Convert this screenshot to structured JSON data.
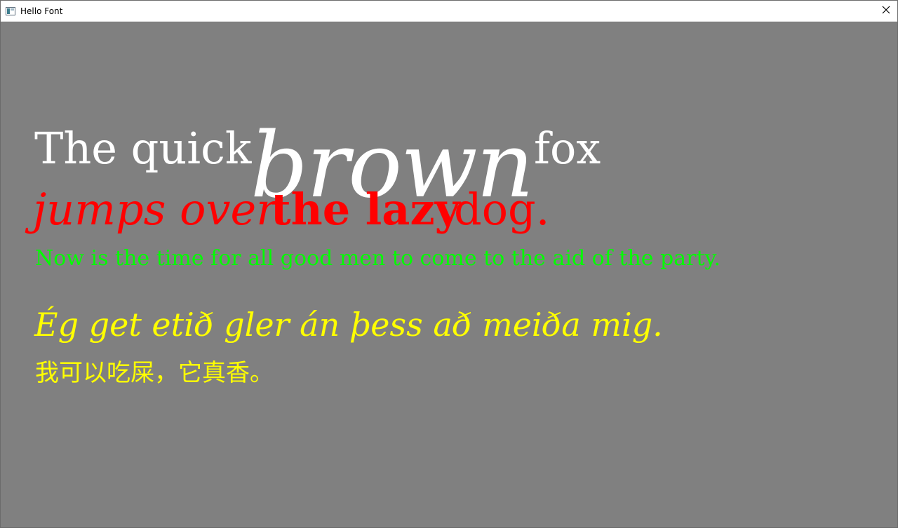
{
  "window": {
    "title": "Hello Font",
    "app_icon": "window-app-icon",
    "close_icon": "close-icon",
    "close_glyph": "✕"
  },
  "colors": {
    "background": "#808080",
    "white": "#ffffff",
    "red": "#ff0000",
    "green": "#00ff00",
    "yellow": "#ffff00"
  },
  "text": {
    "line1": {
      "the_quick": "The quick",
      "brown": "brown",
      "fox": "fox"
    },
    "line2": {
      "jumps_over": "jumps over",
      "the_lazy": "the lazy",
      "dog": "dog."
    },
    "line3": "Now is the time for all good men to come to the aid of the party.",
    "line4": "Ég get etið gler án þess að meiða mig.",
    "line5": "我可以吃屎，它真香。"
  }
}
